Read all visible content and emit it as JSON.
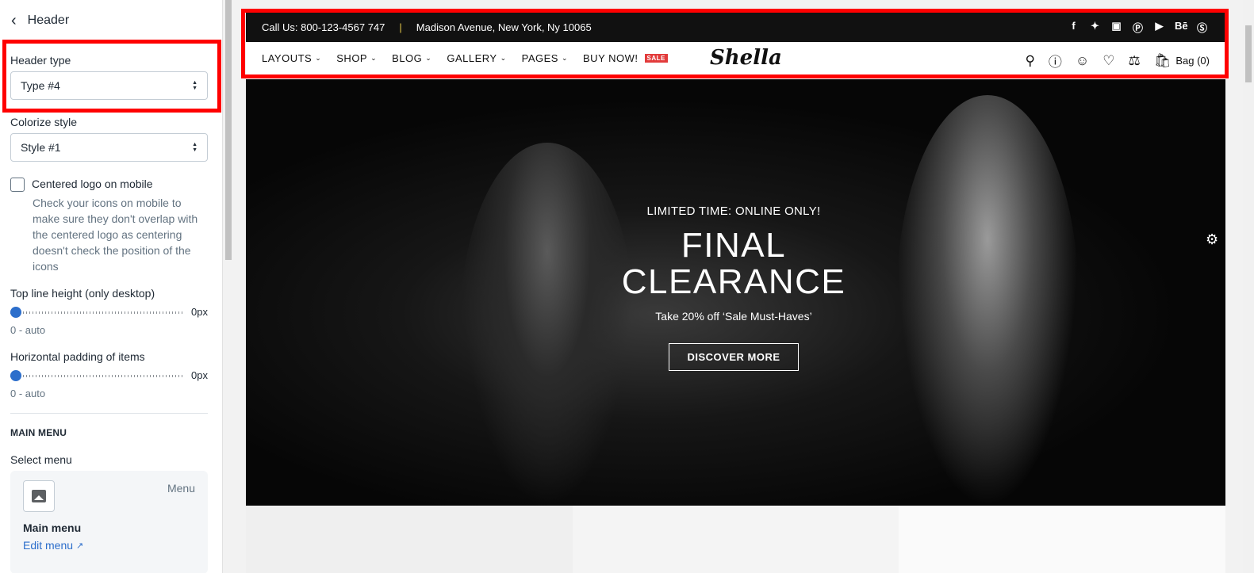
{
  "panel": {
    "back_label": "<",
    "title": "Header",
    "header_type": {
      "label": "Header type",
      "value": "Type #4"
    },
    "colorize": {
      "label": "Colorize style",
      "value": "Style #1"
    },
    "centered_logo": {
      "label": "Centered logo on mobile",
      "checked": false,
      "help": "Check your icons on mobile to make sure they don't overlap with the centered logo as centering doesn't check the position of the icons"
    },
    "top_line": {
      "label": "Top line height (only desktop)",
      "value": "0px",
      "sub": "0 - auto"
    },
    "h_padding": {
      "label": "Horizontal padding of items",
      "value": "0px",
      "sub": "0 - auto"
    },
    "main_menu": {
      "section": "MAIN MENU",
      "select_label": "Select menu",
      "tag": "Menu",
      "name": "Main menu",
      "edit": "Edit menu"
    }
  },
  "store": {
    "topline": {
      "phone": "Call Us: 800-123-4567 747",
      "separator": "|",
      "address": "Madison Avenue, New York, Ny 10065"
    },
    "socials": [
      "f",
      "t",
      "ig",
      "p",
      "yt",
      "Bē",
      "s"
    ],
    "nav": [
      {
        "label": "LAYOUTS"
      },
      {
        "label": "SHOP"
      },
      {
        "label": "BLOG"
      },
      {
        "label": "GALLERY"
      },
      {
        "label": "PAGES"
      }
    ],
    "buy_now": "BUY NOW!",
    "sale": "SALE",
    "logo": "Shella",
    "bag": "Bag (0)",
    "hero": {
      "eyebrow": "LIMITED TIME: ONLINE ONLY!",
      "headline_1": "FINAL",
      "headline_2": "CLEARANCE",
      "tagline": "Take 20% off ‘Sale Must-Haves’",
      "cta": "DISCOVER MORE"
    }
  },
  "icons": [
    "chevron-left-icon",
    "select-arrows-icon",
    "image-icon",
    "external-link-icon",
    "search-icon",
    "help-icon",
    "user-icon",
    "heart-icon",
    "compare-icon",
    "bag-icon",
    "gear-icon"
  ],
  "colors": {
    "accent": "#2c6ecb",
    "highlight": "#ff0000",
    "sale": "#e23b3b",
    "topline": "#111111"
  }
}
